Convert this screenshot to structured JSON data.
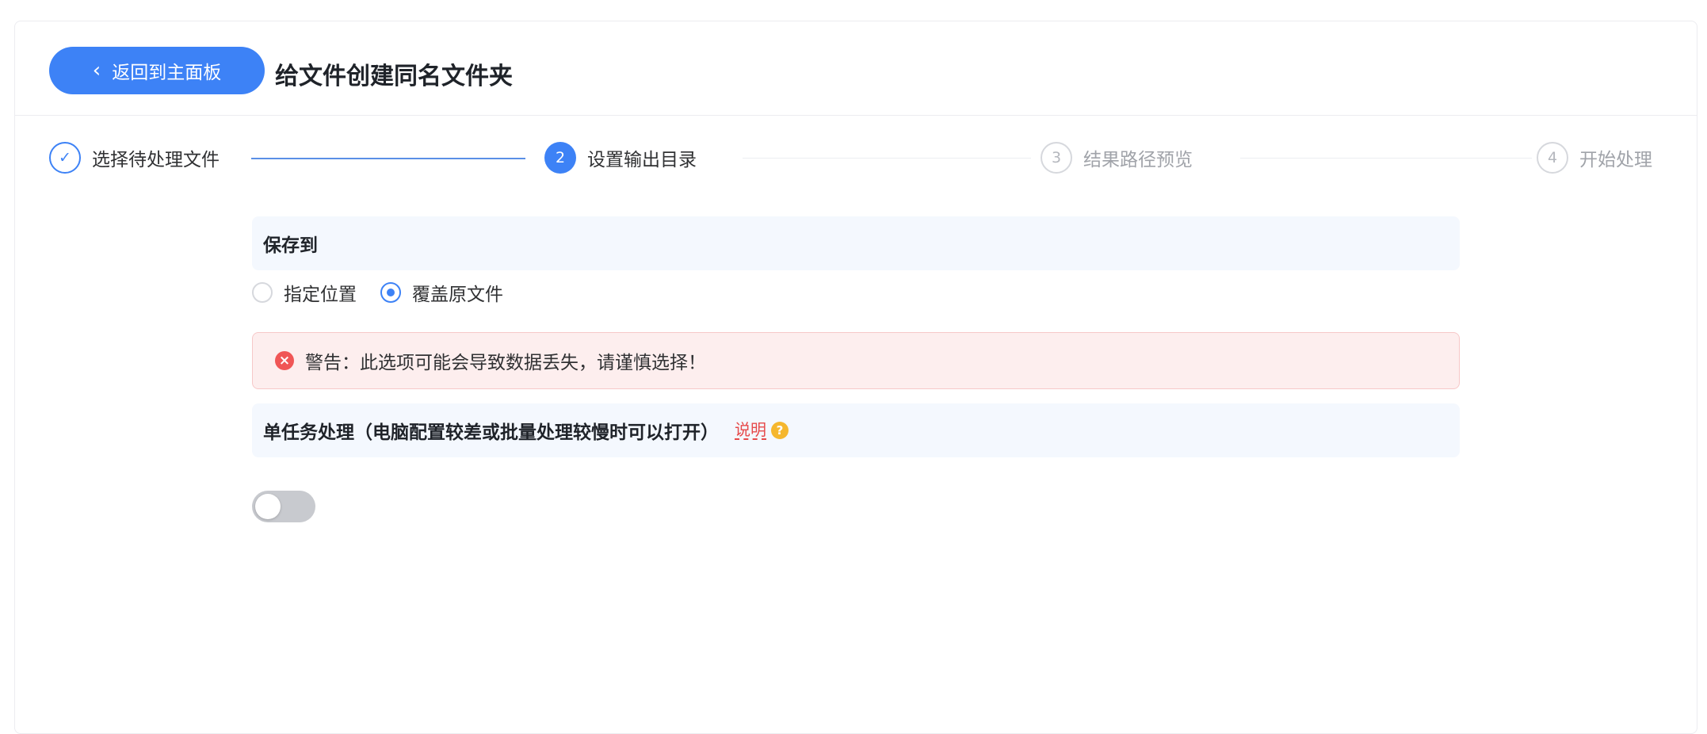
{
  "header": {
    "back_label": "返回到主面板",
    "title": "给文件创建同名文件夹"
  },
  "steps": [
    {
      "number": "✓",
      "label": "选择待处理文件",
      "state": "done"
    },
    {
      "number": "2",
      "label": "设置输出目录",
      "state": "active"
    },
    {
      "number": "3",
      "label": "结果路径预览",
      "state": "todo"
    },
    {
      "number": "4",
      "label": "开始处理",
      "state": "todo"
    }
  ],
  "save_section": {
    "title": "保存到",
    "options": [
      {
        "label": "指定位置",
        "checked": false
      },
      {
        "label": "覆盖原文件",
        "checked": true
      }
    ],
    "warning": "警告：此选项可能会导致数据丢失，请谨慎选择！"
  },
  "single_task": {
    "title": "单任务处理（电脑配置较差或批量处理较慢时可以打开）",
    "explain_label": "说明",
    "help_icon": "?",
    "enabled": false
  },
  "colors": {
    "accent": "#3d82f6",
    "warning_bg": "#fdeeee",
    "warning_icon": "#f05656",
    "help_icon": "#f5b72e"
  }
}
